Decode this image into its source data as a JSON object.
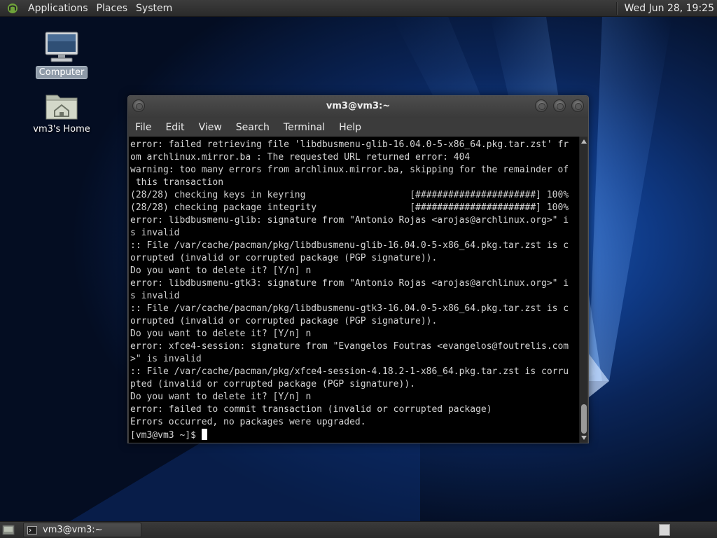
{
  "top_panel": {
    "menus": [
      "Applications",
      "Places",
      "System"
    ],
    "clock": "Wed Jun 28, 19:25"
  },
  "desktop_icons": [
    {
      "label": "Computer",
      "icon": "computer-icon",
      "selected": true
    },
    {
      "label": "vm3's Home",
      "icon": "home-folder-icon",
      "selected": false
    }
  ],
  "terminal": {
    "title": "vm3@vm3:~",
    "menus": [
      "File",
      "Edit",
      "View",
      "Search",
      "Terminal",
      "Help"
    ],
    "lines": [
      "error: failed retrieving file 'libdbusmenu-glib-16.04.0-5-x86_64.pkg.tar.zst' fr",
      "om archlinux.mirror.ba : The requested URL returned error: 404",
      "warning: too many errors from archlinux.mirror.ba, skipping for the remainder of",
      " this transaction",
      "(28/28) checking keys in keyring                   [######################] 100%",
      "(28/28) checking package integrity                 [######################] 100%",
      "error: libdbusmenu-glib: signature from \"Antonio Rojas <arojas@archlinux.org>\" i",
      "s invalid",
      ":: File /var/cache/pacman/pkg/libdbusmenu-glib-16.04.0-5-x86_64.pkg.tar.zst is c",
      "orrupted (invalid or corrupted package (PGP signature)).",
      "Do you want to delete it? [Y/n] n",
      "error: libdbusmenu-gtk3: signature from \"Antonio Rojas <arojas@archlinux.org>\" i",
      "s invalid",
      ":: File /var/cache/pacman/pkg/libdbusmenu-gtk3-16.04.0-5-x86_64.pkg.tar.zst is c",
      "orrupted (invalid or corrupted package (PGP signature)).",
      "Do you want to delete it? [Y/n] n",
      "error: xfce4-session: signature from \"Evangelos Foutras <evangelos@foutrelis.com",
      ">\" is invalid",
      ":: File /var/cache/pacman/pkg/xfce4-session-4.18.2-1-x86_64.pkg.tar.zst is corru",
      "pted (invalid or corrupted package (PGP signature)).",
      "Do you want to delete it? [Y/n] n",
      "error: failed to commit transaction (invalid or corrupted package)",
      "Errors occurred, no packages were upgraded."
    ],
    "prompt": "[vm3@vm3 ~]$ "
  },
  "taskbar": {
    "task_label": "vm3@vm3:~"
  }
}
